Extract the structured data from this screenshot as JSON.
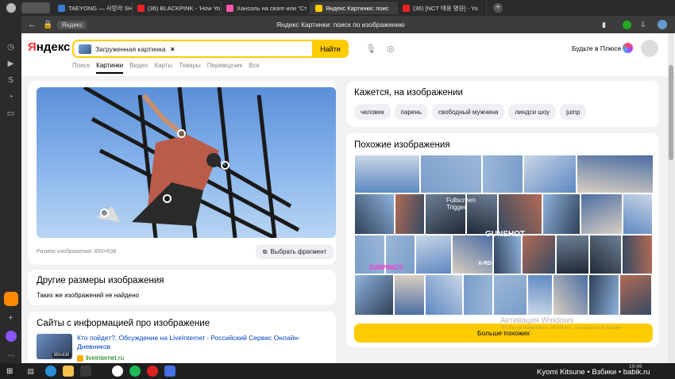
{
  "tabs": [
    {
      "title": "TAEYONG — 사랑라 SHAL",
      "color": "#3a7bd5"
    },
    {
      "title": "(36) BLACKPINK - 'How Yo",
      "color": "#e22"
    },
    {
      "title": "Ханcоль на свэге или \"Ст",
      "color": "#f5a"
    },
    {
      "title": "Яндекс Картинки: поис",
      "color": "#fc0"
    },
    {
      "title": "(36) [NCT 태용 명윤] - Yo",
      "color": "#e22"
    }
  ],
  "window": {
    "title": "Яндекс Картинки: поиск по изображению",
    "address": "Яндекс"
  },
  "header": {
    "logo": "Яндекс",
    "search_chip": "Загруженная картинка",
    "search_button": "Найти",
    "plus": "Будьте в Плюсе",
    "nav": [
      "Поиск",
      "Картинки",
      "Видео",
      "Карты",
      "Товары",
      "Переводчик",
      "Все"
    ]
  },
  "image_panel": {
    "size_label": "Размер изображения: 850×638",
    "crop_button": "Выбрать фрагмент"
  },
  "other_sizes": {
    "title": "Другие размеры изображения",
    "text": "Таких же изображений не найдено"
  },
  "sites": {
    "title": "Сайты с информацией про изображение",
    "link": "Кто пойдет?. Обсуждение на LiveInternet - Российский Сервис Онлайн-Дневников",
    "domain": "liveinternet.ru",
    "thumb_label": "850x638"
  },
  "tags_card": {
    "title": "Кажется, на изображении",
    "tags": [
      "человек",
      "парень",
      "свободный мужчина",
      "линдси шоу",
      "jump"
    ]
  },
  "similar": {
    "title": "Похожие изображения",
    "more_button": "Больше похожих",
    "overlay_texts": [
      "Fullscreen Trigger",
      "GUNSHOT",
      "JUMPING!!!",
      "X-RD"
    ]
  },
  "watermark": {
    "line1": "Активация Windows",
    "line2": "Чтобы активировать Windows, перейдите в раздел",
    "line3": "\"Параметры\"."
  },
  "taskbar": {
    "clock": "19:49",
    "caption": "Kyomi Kitsune • Взбики • babik.ru"
  }
}
